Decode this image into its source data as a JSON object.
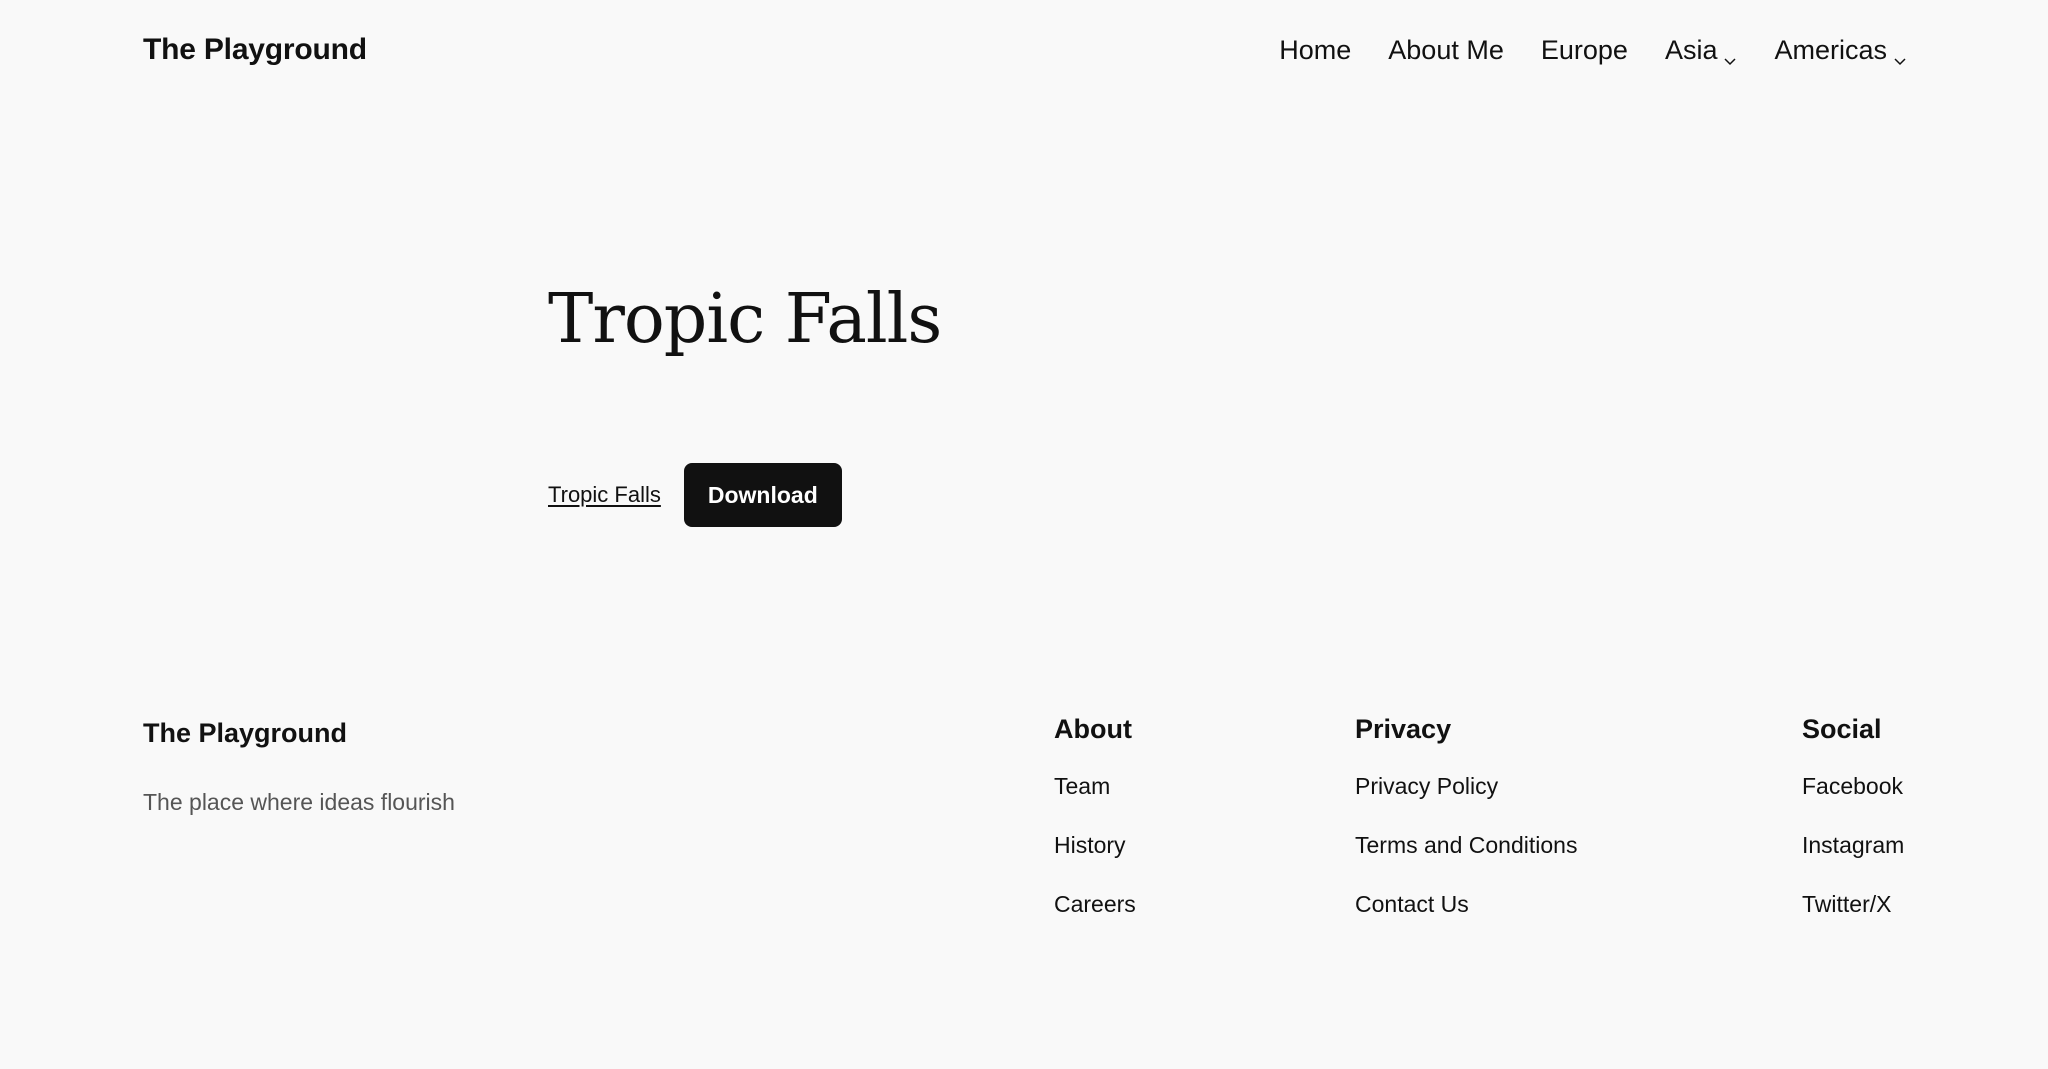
{
  "header": {
    "site_title": "The Playground",
    "nav": [
      {
        "label": "Home",
        "has_submenu": false
      },
      {
        "label": "About Me",
        "has_submenu": false
      },
      {
        "label": "Europe",
        "has_submenu": false
      },
      {
        "label": "Asia",
        "has_submenu": true,
        "icon": "chevron-down-icon"
      },
      {
        "label": "Americas",
        "has_submenu": true,
        "icon": "chevron-down-icon"
      }
    ]
  },
  "hero": {
    "title": "Tropic Falls",
    "file_link": "Tropic Falls",
    "download_label": "Download"
  },
  "footer": {
    "title": "The Playground",
    "tagline": "The place where ideas flourish",
    "columns": [
      {
        "heading": "About",
        "links": [
          "Team",
          "History",
          "Careers"
        ]
      },
      {
        "heading": "Privacy",
        "links": [
          "Privacy Policy",
          "Terms and Conditions",
          "Contact Us"
        ]
      },
      {
        "heading": "Social",
        "links": [
          "Facebook",
          "Instagram",
          "Twitter/X"
        ]
      }
    ]
  },
  "colors": {
    "background": "#f9f9f9",
    "text": "#111111",
    "muted_text": "#555555",
    "button_bg": "#111111",
    "button_text": "#ffffff"
  }
}
